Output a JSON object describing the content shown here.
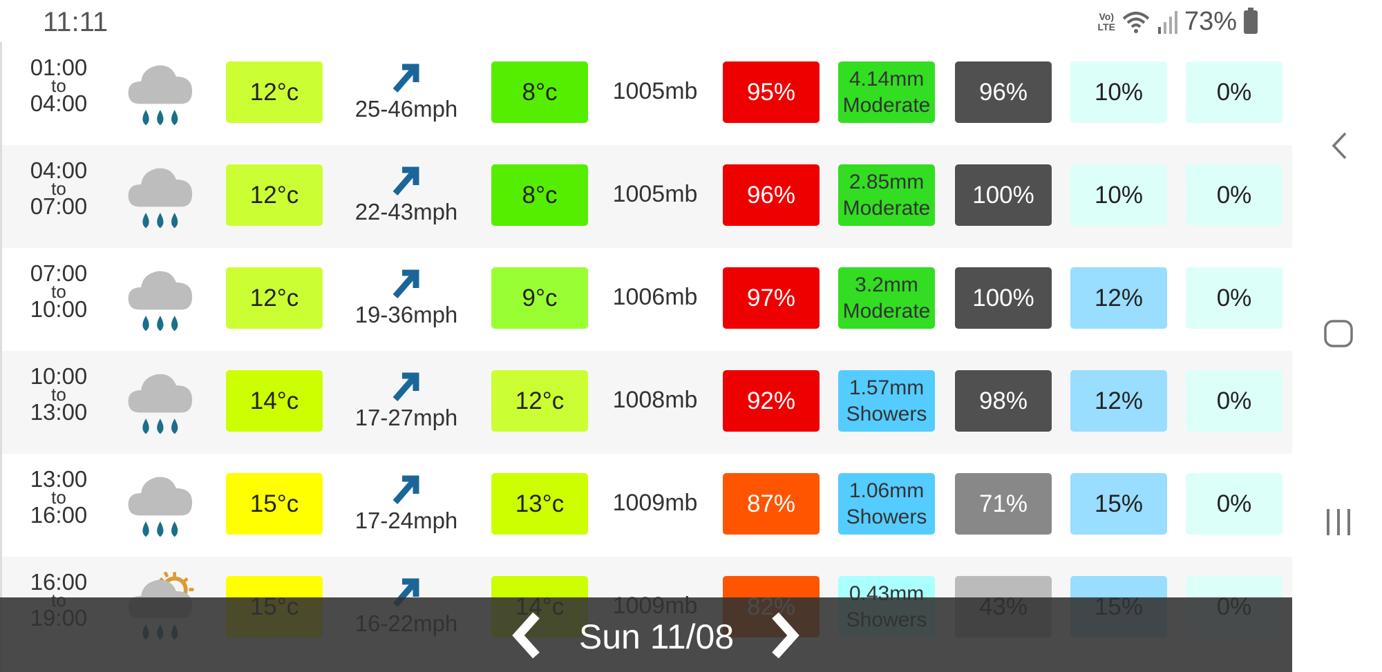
{
  "status_bar": {
    "time": "11:11",
    "volte": "Vo) LTE",
    "battery": "73%"
  },
  "rows": [
    {
      "from": "01:00",
      "to_label": "to",
      "to": "04:00",
      "icon": "rain-cloud-icon",
      "temp": "12°c",
      "temp_color": "#ccff33",
      "wind": "25-46mph",
      "feels": "8°c",
      "feels_color": "#55ee00",
      "pressure": "1005mb",
      "humidity": "95%",
      "humidity_color": "#ee0000",
      "precip_amount": "4.14mm",
      "precip_type": "Moderate",
      "precip_color": "#33dd22",
      "cloud": "96%",
      "cloud_color": "#505050",
      "col9": "10%",
      "col9_color": "#ddfffa",
      "col10": "0%",
      "col10_color": "#ddfffa"
    },
    {
      "from": "04:00",
      "to_label": "to",
      "to": "07:00",
      "icon": "rain-cloud-icon",
      "temp": "12°c",
      "temp_color": "#ccff33",
      "wind": "22-43mph",
      "feels": "8°c",
      "feels_color": "#55ee00",
      "pressure": "1005mb",
      "humidity": "96%",
      "humidity_color": "#ee0000",
      "precip_amount": "2.85mm",
      "precip_type": "Moderate",
      "precip_color": "#33dd22",
      "cloud": "100%",
      "cloud_color": "#505050",
      "col9": "10%",
      "col9_color": "#ddfffa",
      "col10": "0%",
      "col10_color": "#ddfffa"
    },
    {
      "from": "07:00",
      "to_label": "to",
      "to": "10:00",
      "icon": "rain-cloud-icon",
      "temp": "12°c",
      "temp_color": "#ccff33",
      "wind": "19-36mph",
      "feels": "9°c",
      "feels_color": "#99ff33",
      "pressure": "1006mb",
      "humidity": "97%",
      "humidity_color": "#ee0000",
      "precip_amount": "3.2mm",
      "precip_type": "Moderate",
      "precip_color": "#33dd22",
      "cloud": "100%",
      "cloud_color": "#505050",
      "col9": "12%",
      "col9_color": "#99ddff",
      "col10": "0%",
      "col10_color": "#ddfffa"
    },
    {
      "from": "10:00",
      "to_label": "to",
      "to": "13:00",
      "icon": "rain-cloud-icon",
      "temp": "14°c",
      "temp_color": "#ccff00",
      "wind": "17-27mph",
      "feels": "12°c",
      "feels_color": "#ccff33",
      "pressure": "1008mb",
      "humidity": "92%",
      "humidity_color": "#ee0000",
      "precip_amount": "1.57mm",
      "precip_type": "Showers",
      "precip_color": "#55ccff",
      "cloud": "98%",
      "cloud_color": "#505050",
      "col9": "12%",
      "col9_color": "#99ddff",
      "col10": "0%",
      "col10_color": "#ddfffa"
    },
    {
      "from": "13:00",
      "to_label": "to",
      "to": "16:00",
      "icon": "rain-cloud-icon",
      "temp": "15°c",
      "temp_color": "#ffff00",
      "wind": "17-24mph",
      "feels": "13°c",
      "feels_color": "#ccff00",
      "pressure": "1009mb",
      "humidity": "87%",
      "humidity_color": "#ff5500",
      "precip_amount": "1.06mm",
      "precip_type": "Showers",
      "precip_color": "#55ccff",
      "cloud": "71%",
      "cloud_color": "#888888",
      "col9": "15%",
      "col9_color": "#99ddff",
      "col10": "0%",
      "col10_color": "#ddfffa"
    },
    {
      "from": "16:00",
      "to_label": "to",
      "to": "19:00",
      "icon": "sun-rain-cloud-icon",
      "temp": "15°c",
      "temp_color": "#ffff00",
      "wind": "16-22mph",
      "feels": "14°c",
      "feels_color": "#ccff00",
      "pressure": "1009mb",
      "humidity": "82%",
      "humidity_color": "#ff5500",
      "precip_amount": "0.43mm",
      "precip_type": "Showers",
      "precip_color": "#aaffff",
      "cloud": "43%",
      "cloud_color": "#bbbbbb",
      "col9": "15%",
      "col9_color": "#99ddff",
      "col10": "0%",
      "col10_color": "#ddfffa"
    }
  ],
  "date_nav": {
    "date": "Sun 11/08"
  }
}
